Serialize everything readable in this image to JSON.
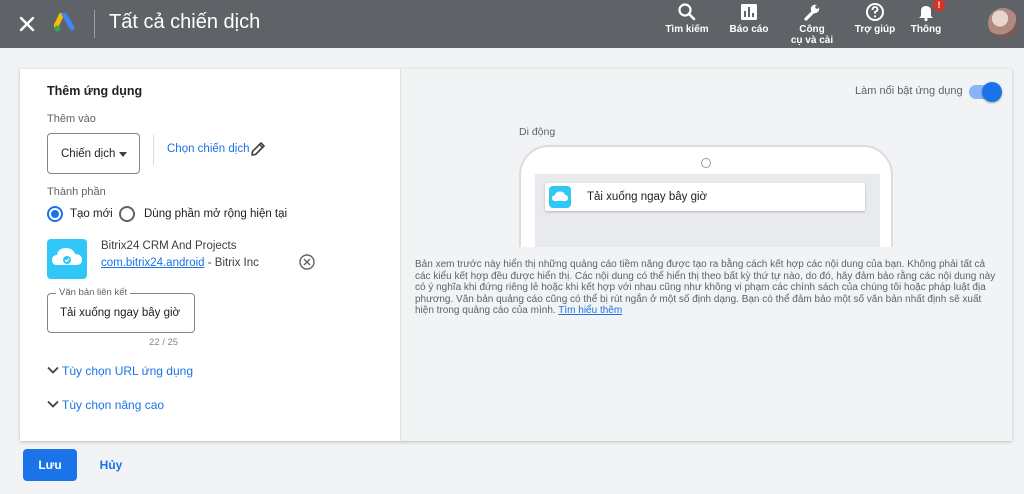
{
  "header": {
    "title": "Tất cả chiến dịch",
    "nav": [
      {
        "label": "Tìm kiếm",
        "icon": "search-icon"
      },
      {
        "label": "Báo cáo",
        "icon": "reports-icon"
      },
      {
        "label_line1": "Công",
        "label_line2": "cụ và cài",
        "icon": "wrench-icon"
      },
      {
        "label": "Trợ giúp",
        "icon": "help-icon"
      },
      {
        "label": "Thông",
        "icon": "bell-icon",
        "badge": "!"
      }
    ]
  },
  "form": {
    "section_title": "Thêm ứng dụng",
    "add_to_label": "Thêm vào",
    "add_to_value": "Chiến dịch",
    "choose_campaign_link": "Chọn chiến dịch",
    "component_label": "Thành phần",
    "radio_new": "Tạo mới",
    "radio_existing": "Dùng phần mở rộng hiện tại",
    "app": {
      "name": "Bitrix24 CRM And Projects",
      "package": "com.bitrix24.android",
      "publisher": " - Bitrix Inc"
    },
    "link_text_label": "Văn bản liên kết",
    "link_text_value": "Tải xuống ngay bây giờ",
    "char_counter": "22 / 25",
    "url_options": "Tùy chọn URL ứng dụng",
    "advanced_options": "Tùy chọn nâng cao"
  },
  "preview": {
    "highlight_label": "Làm nổi bật ứng dụng",
    "highlight_on": true,
    "device_label": "Di động",
    "ad_text": "Tải xuống ngay bây giờ",
    "note": "Bản xem trước này hiển thị những quảng cáo tiềm năng được tạo ra bằng cách kết hợp các nội dung của bạn. Không phải tất cả các kiểu kết hợp đều được hiển thị. Các nội dung có thể hiển thị theo bất kỳ thứ tự nào, do đó, hãy đảm bảo rằng các nội dung này có ý nghĩa khi đứng riêng lẻ hoặc khi kết hợp với nhau cũng như không vi phạm các chính sách của chúng tôi hoặc pháp luật địa phương. Văn bản quảng cáo cũng có thể bị rút ngắn ở một số định dạng. Bạn có thể đảm bảo một số văn bản nhất định sẽ xuất hiện trong quảng cáo của mình. ",
    "learn_more": "Tìm hiểu thêm"
  },
  "footer": {
    "save_label": "Lưu",
    "cancel_label": "Hủy"
  },
  "colors": {
    "accent": "#1a73e8",
    "topbar": "#5f6368",
    "badge": "#d93025"
  }
}
